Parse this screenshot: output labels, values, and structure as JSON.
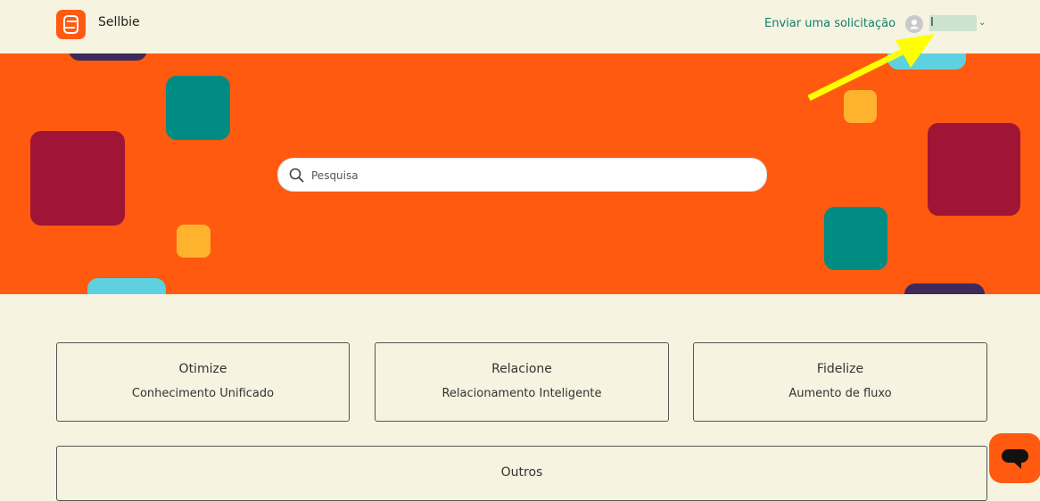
{
  "header": {
    "brand": "Sellbie",
    "request_link": "Enviar uma solicitação",
    "username": "I",
    "user_icon": "user-avatar-icon",
    "menu_icon": "chevron-down-icon"
  },
  "search": {
    "placeholder": "Pesquisa",
    "icon": "search-icon"
  },
  "categories": [
    {
      "title": "Otimize",
      "subtitle": "Conhecimento Unificado"
    },
    {
      "title": "Relacione",
      "subtitle": "Relacionamento Inteligente"
    },
    {
      "title": "Fidelize",
      "subtitle": "Aumento de fluxo"
    },
    {
      "title": "Outros"
    }
  ],
  "chat": {
    "icon": "chat-icon"
  },
  "colors": {
    "accent": "#ff5a0f",
    "link": "#0f7f6e",
    "background": "#f6f3e0",
    "annotation_arrow": "#ffff00"
  }
}
